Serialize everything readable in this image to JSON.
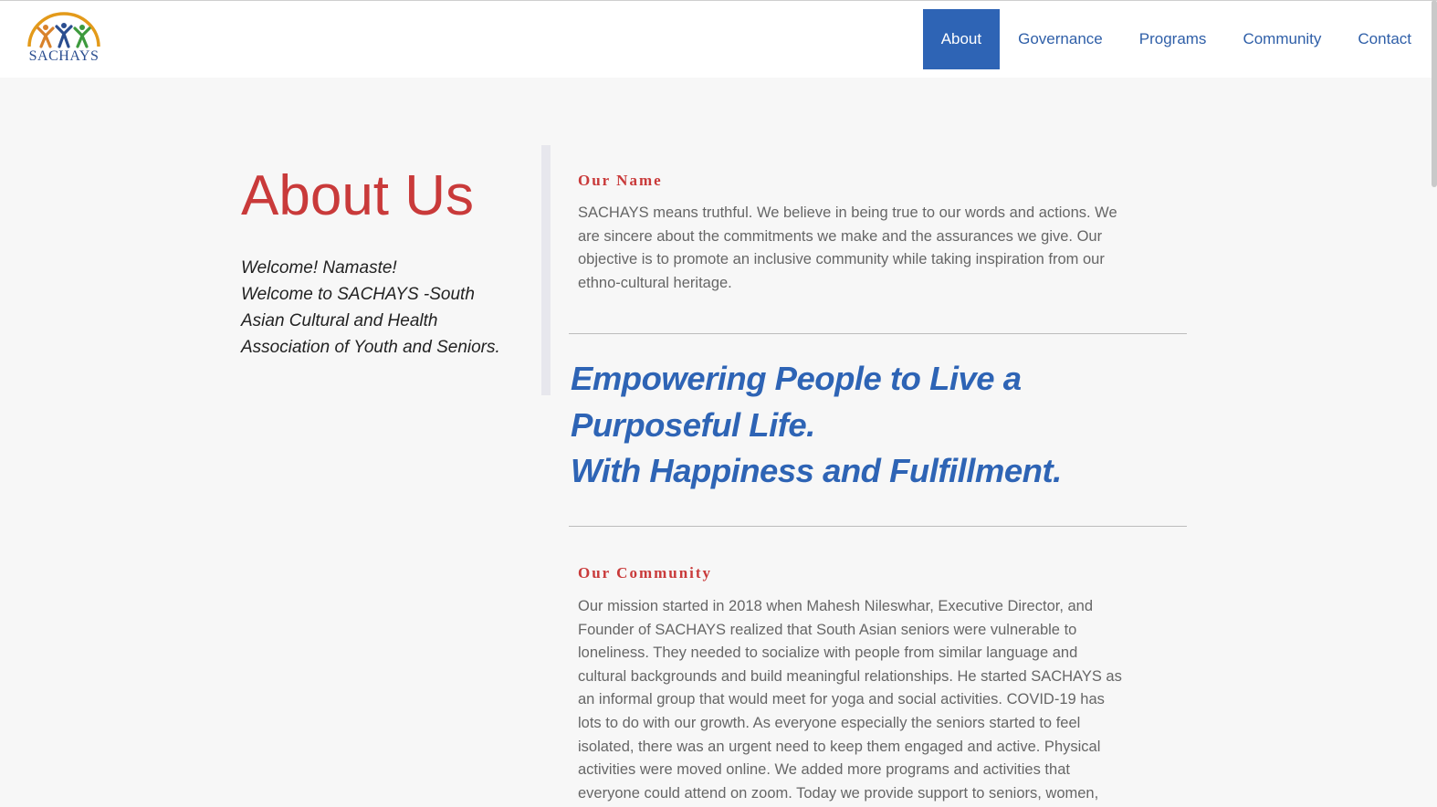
{
  "header": {
    "logo_text": "SACHAYS",
    "nav": [
      {
        "label": "About",
        "active": true
      },
      {
        "label": "Governance",
        "active": false
      },
      {
        "label": "Programs",
        "active": false
      },
      {
        "label": "Community",
        "active": false
      },
      {
        "label": "Contact",
        "active": false
      }
    ]
  },
  "intro": {
    "title": "About Us",
    "welcome_lines": [
      "Welcome! Namaste!",
      "Welcome to SACHAYS -South",
      "Asian Cultural and Health",
      "Association of Youth and Seniors."
    ]
  },
  "our_name": {
    "heading": "Our Name",
    "lines": [
      "SACHAYS means truthful. We believe in being true to our words and actions. We",
      "are sincere about the commitments we make and the assurances we give. Our",
      "objective is to promote an inclusive community while taking inspiration from our",
      "ethno-cultural heritage."
    ]
  },
  "tagline": {
    "lines": [
      "Empowering People to Live a",
      "Purposeful Life.",
      "With Happiness and Fulfillment."
    ]
  },
  "our_community": {
    "heading": "Our Community",
    "lines": [
      "Our mission started in 2018 when Mahesh Nileswhar, Executive Director, and",
      "Founder of SACHAYS realized that South Asian seniors were vulnerable to",
      "loneliness. They needed to socialize with people from similar language and",
      "cultural backgrounds and build meaningful relationships. He started SACHAYS as",
      "an informal group that would meet for yoga and social activities. COVID-19 has",
      "lots to do with our growth. As everyone especially the seniors started to feel",
      "isolated, there was an urgent need to keep them engaged and active. Physical",
      "activities were moved online. We added more programs and activities that",
      "everyone could attend on zoom. Today we provide support to seniors, women,"
    ]
  },
  "colors": {
    "brand_blue": "#2e64b5",
    "heading_red": "#c93a3a",
    "page_bg": "#f7f7f7"
  }
}
